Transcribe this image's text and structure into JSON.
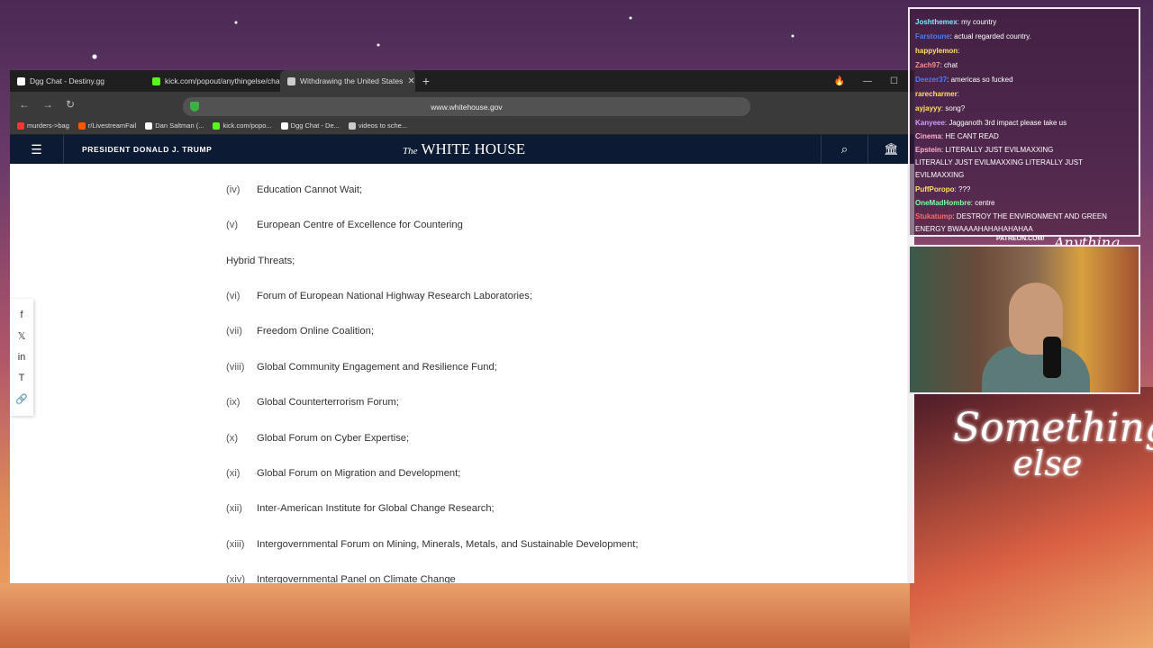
{
  "browser": {
    "tabs": [
      {
        "label": "Dgg Chat - Destiny.gg",
        "color": "#ffffff",
        "active": false
      },
      {
        "label": "kick.com/popout/anythingelse/chat",
        "color": "#53fc18",
        "active": false
      },
      {
        "label": "Withdrawing the United States",
        "color": "#cccccc",
        "active": true
      }
    ],
    "new_tab": "+",
    "url": "www.whitehouse.gov",
    "bookmarks": [
      {
        "label": "murders->bag",
        "color": "#ff3333"
      },
      {
        "label": "r/LivestreamFail",
        "color": "#ff5700"
      },
      {
        "label": "Dan Saltman (...",
        "color": "#ffffff"
      },
      {
        "label": "kick.com/popo...",
        "color": "#53fc18"
      },
      {
        "label": "Dgg Chat - De...",
        "color": "#ffffff"
      },
      {
        "label": "videos to sche...",
        "color": "#cccccc"
      }
    ]
  },
  "site": {
    "president": "PRESIDENT DONALD J. TRUMP",
    "logo_the": "The",
    "logo_name": "WHITE HOUSE"
  },
  "items": [
    {
      "num": "(iv)",
      "text": "Education Cannot Wait;"
    },
    {
      "num": "(v)",
      "text": "European Centre of Excellence for Countering"
    },
    {
      "num": "",
      "text": "Hybrid Threats;"
    },
    {
      "num": "(vi)",
      "text": "Forum of European National Highway Research Laboratories;"
    },
    {
      "num": "(vii)",
      "text": "Freedom Online Coalition;"
    },
    {
      "num": "(viii)",
      "text": "Global Community Engagement and Resilience Fund;"
    },
    {
      "num": "(ix)",
      "text": "Global Counterterrorism Forum;"
    },
    {
      "num": "(x)",
      "text": "Global Forum on Cyber Expertise;"
    },
    {
      "num": "(xi)",
      "text": "Global Forum on Migration and Development;"
    },
    {
      "num": "(xii)",
      "text": "Inter-American Institute for Global Change Research;"
    },
    {
      "num": "(xiii)",
      "text": "Intergovernmental Forum on Mining, Minerals, Metals, and Sustainable Development;"
    },
    {
      "num": "(xiv)",
      "text": "Intergovernmental Panel on Climate Change"
    }
  ],
  "chat": [
    {
      "user": "Joshthemex",
      "text": "my country",
      "color": "#7ee8ff"
    },
    {
      "user": "Farstoune",
      "text": "actual regarded country.",
      "color": "#4a7cff"
    },
    {
      "user": "happylemon",
      "text": "",
      "color": "#ffe066"
    },
    {
      "user": "Zach97",
      "text": "chat",
      "color": "#ff8a8a"
    },
    {
      "user": "Deezer37",
      "text": "americas so fucked",
      "color": "#4a7cff"
    },
    {
      "user": "rarecharmer",
      "text": "",
      "color": "#ffe066"
    },
    {
      "user": "ayjayyy",
      "text": "song?",
      "color": "#ffe066"
    },
    {
      "user": "Kanyeee",
      "text": "Jagganoth 3rd impact please take us",
      "color": "#c9a0ff"
    },
    {
      "user": "Cinema",
      "text": "HE CANT READ",
      "color": "#ffb0d0"
    },
    {
      "user": "Epstein",
      "text": "LITERALLY JUST EVILMAXXING",
      "color": "#ffb0d0"
    },
    {
      "user": "",
      "text": "LITERALLY JUST EVILMAXXING     LITERALLY JUST",
      "color": "#ffffff"
    },
    {
      "user": "",
      "text": "EVILMAXXING",
      "color": "#ffffff"
    },
    {
      "user": "PuffPoropo",
      "text": "???",
      "color": "#ffe066"
    },
    {
      "user": "OneMadHombre",
      "text": "centre",
      "color": "#7effa0"
    },
    {
      "user": "Stukatump",
      "text": "DESTROY THE ENVIRONMENT AND GREEN",
      "color": "#ff6a6a"
    },
    {
      "user": "",
      "text": "ENERGY    BWAAAAHAHAHAHAHAA",
      "color": "#ffffff"
    }
  ],
  "patreon": "PATREON.COM/",
  "brand": "Anything Else",
  "overlay_script": {
    "line1": "Something",
    "line2": "else"
  }
}
